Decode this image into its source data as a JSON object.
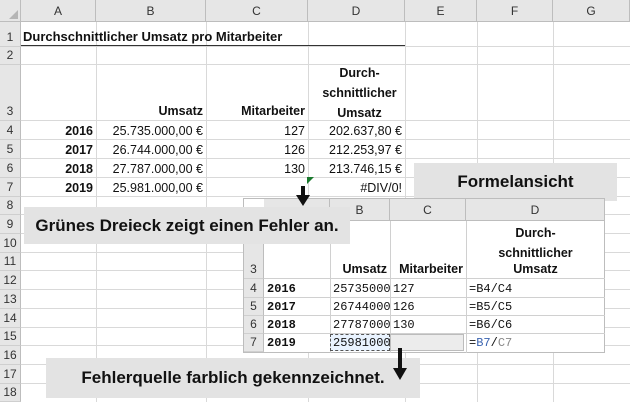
{
  "sheet": {
    "columns": [
      "A",
      "B",
      "C",
      "D",
      "E",
      "F",
      "G"
    ],
    "rows": [
      "1",
      "2",
      "3",
      "4",
      "5",
      "6",
      "7",
      "8",
      "9",
      "10",
      "11",
      "12",
      "13",
      "14",
      "15",
      "16",
      "17",
      "18"
    ],
    "title": "Durchschnittlicher Umsatz pro Mitarbeiter",
    "headers": {
      "umsatz": "Umsatz",
      "mitarbeiter": "Mitarbeiter",
      "d_line1": "Durch-",
      "d_line2": "schnittlicher",
      "d_line3": "Umsatz"
    },
    "data": [
      {
        "year": "2016",
        "umsatz": "25.735.000,00 €",
        "mitarbeiter": "127",
        "avg": "202.637,80 €"
      },
      {
        "year": "2017",
        "umsatz": "26.744.000,00 €",
        "mitarbeiter": "126",
        "avg": "212.253,97 €"
      },
      {
        "year": "2018",
        "umsatz": "27.787.000,00 €",
        "mitarbeiter": "130",
        "avg": "213.746,15 €"
      },
      {
        "year": "2019",
        "umsatz": "25.981.000,00 €",
        "mitarbeiter": "",
        "avg": "#DIV/0!"
      }
    ]
  },
  "callouts": {
    "formelansicht": "Formelansicht",
    "green_triangle": "Grünes Dreieck zeigt einen Fehler an.",
    "error_source": "Fehlerquelle farblich gekennzeichnet."
  },
  "formula_view": {
    "columns": [
      "B",
      "C",
      "D"
    ],
    "rows": [
      "3",
      "4",
      "5",
      "6",
      "7"
    ],
    "headers": {
      "umsatz": "Umsatz",
      "mitarbeiter": "Mitarbeiter",
      "d_line1": "Durch-",
      "d_line2": "schnittlicher",
      "d_line3": "Umsatz"
    },
    "data": [
      {
        "year": "2016",
        "umsatz": "25735000",
        "mitarbeiter": "127",
        "formula": "=B4/C4"
      },
      {
        "year": "2017",
        "umsatz": "26744000",
        "mitarbeiter": "126",
        "formula": "=B5/C5"
      },
      {
        "year": "2018",
        "umsatz": "27787000",
        "mitarbeiter": "130",
        "formula": "=B6/C6"
      },
      {
        "year": "2019",
        "umsatz": "25981000",
        "mitarbeiter": "",
        "formula_eq": "=",
        "formula_ref1": "B7",
        "formula_op": "/",
        "formula_ref2": "C7"
      }
    ]
  },
  "colors": {
    "error_indicator": "#1a7a2e",
    "ref_highlight_b": "#3a63b0",
    "ref_highlight_c": "#888888",
    "callout_bg": "#e3e3e3"
  }
}
